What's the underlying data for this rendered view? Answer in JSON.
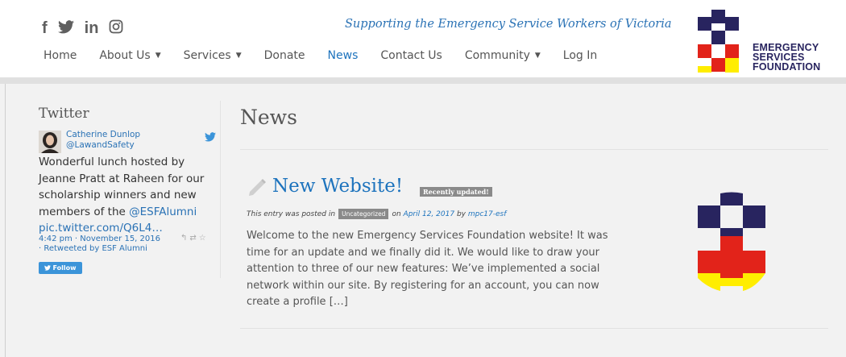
{
  "header": {
    "social": [
      {
        "name": "facebook-icon",
        "glyph": "f"
      },
      {
        "name": "twitter-icon",
        "glyph": "twitter"
      },
      {
        "name": "linkedin-icon",
        "glyph": "in"
      },
      {
        "name": "instagram-icon",
        "glyph": "instagram"
      }
    ],
    "tagline": "Supporting the Emergency Service Workers of Victoria",
    "nav": [
      {
        "label": "Home",
        "dropdown": false,
        "active": false
      },
      {
        "label": "About Us",
        "dropdown": true,
        "active": false
      },
      {
        "label": "Services",
        "dropdown": true,
        "active": false
      },
      {
        "label": "Donate",
        "dropdown": false,
        "active": false
      },
      {
        "label": "News",
        "dropdown": false,
        "active": true
      },
      {
        "label": "Contact Us",
        "dropdown": false,
        "active": false
      },
      {
        "label": "Community",
        "dropdown": true,
        "active": false
      },
      {
        "label": "Log In",
        "dropdown": false,
        "active": false
      }
    ],
    "logo": {
      "line1": "EMERGENCY",
      "line2": "SERVICES",
      "line3": "FOUNDATION",
      "colors": {
        "navy": "#28245f",
        "red": "#e2231a",
        "yellow": "#ffed00"
      }
    }
  },
  "sidebar": {
    "title": "Twitter",
    "tweet": {
      "name": "Catherine Dunlop",
      "handle": "@LawandSafety",
      "text": "Wonderful lunch hosted by Jeanne Pratt at Raheen for our scholarship winners and new members of the ",
      "mention": "@ESFAlumni",
      "link": "pic.twitter.com/Q6L4…",
      "time": "4:42 pm · November 15, 2016",
      "retweet": "· Retweeted by ESF Alumni",
      "follow_label": "Follow"
    }
  },
  "main": {
    "title": "News",
    "post": {
      "title": "New Website!",
      "badge": "Recently updated!",
      "meta_prefix": "This entry was posted in",
      "category": "Uncategorized",
      "meta_on": "on",
      "date": "April 12, 2017",
      "meta_by": "by",
      "author": "mpc17-esf",
      "excerpt": "Welcome to the new Emergency Services Foundation website! It was time for an update and we finally did it. We would like to draw your attention to three of our new features: We’ve implemented a social network within our site. By registering for an account, you can now create a profile […]"
    }
  },
  "colors": {
    "accent": "#1d73bd",
    "link": "#2a72b5",
    "twitter": "#3b94d9"
  }
}
